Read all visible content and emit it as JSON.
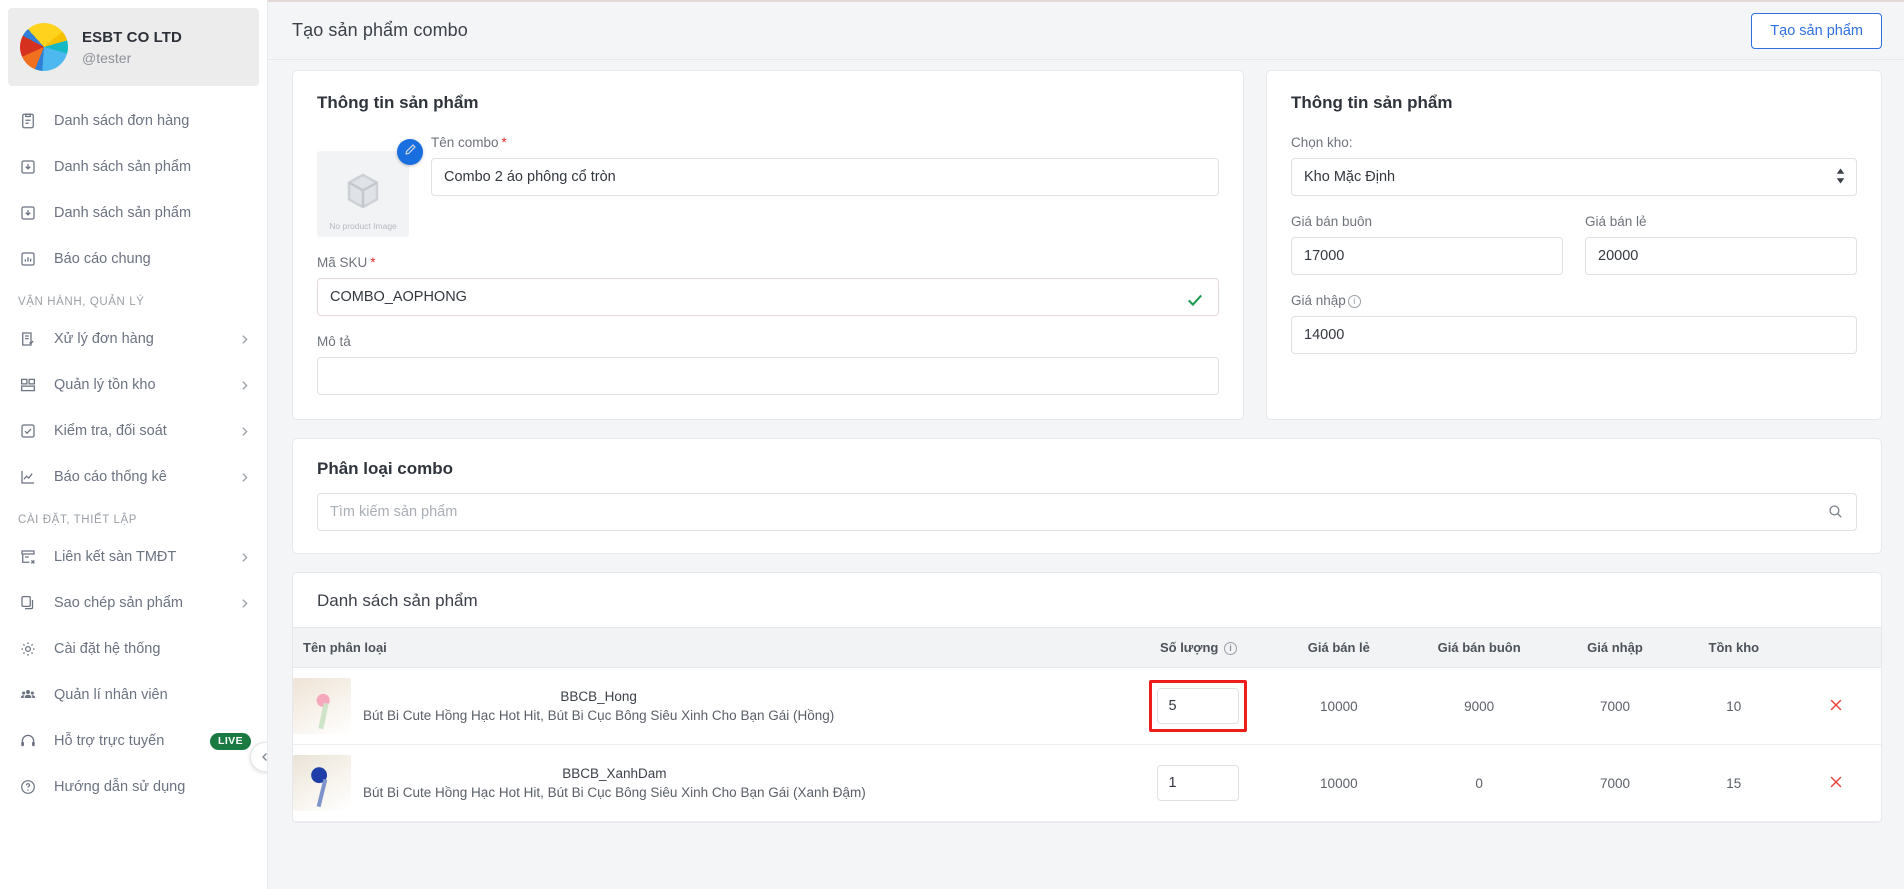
{
  "sidebar": {
    "brand": {
      "name": "ESBT CO LTD",
      "handle": "@tester"
    },
    "items": [
      {
        "label": "Danh sách đơn hàng",
        "icon": "clipboard-icon",
        "chevron": false
      },
      {
        "label": "Danh sách sản phẩm",
        "icon": "download-box-icon",
        "chevron": false
      },
      {
        "label": "Danh sách sản phẩm",
        "icon": "download-box-icon",
        "chevron": false
      },
      {
        "label": "Báo cáo chung",
        "icon": "bar-chart-icon",
        "chevron": false
      }
    ],
    "section_operations": "VẬN HÀNH, QUẢN LÝ",
    "operations": [
      {
        "label": "Xử lý đơn hàng",
        "icon": "order-process-icon",
        "chevron": true
      },
      {
        "label": "Quản lý tồn kho",
        "icon": "inventory-icon",
        "chevron": true
      },
      {
        "label": "Kiểm tra, đối soát",
        "icon": "checkbox-icon",
        "chevron": true
      },
      {
        "label": "Báo cáo thống kê",
        "icon": "line-chart-icon",
        "chevron": true
      }
    ],
    "section_settings": "CÀI ĐẶT, THIẾT LẬP",
    "settings": [
      {
        "label": "Liên kết sàn TMĐT",
        "icon": "store-link-icon",
        "chevron": true
      },
      {
        "label": "Sao chép sản phẩm",
        "icon": "copy-icon",
        "chevron": true
      },
      {
        "label": "Cài đặt hệ thống",
        "icon": "gear-icon",
        "chevron": false
      },
      {
        "label": "Quản lí nhân viên",
        "icon": "users-icon",
        "chevron": false
      },
      {
        "label": "Hỗ trợ trực tuyến",
        "icon": "headset-icon",
        "chevron": false,
        "badge": "LIVE"
      },
      {
        "label": "Hướng dẫn sử dụng",
        "icon": "question-circle-icon",
        "chevron": false
      }
    ]
  },
  "topbar": {
    "title": "Tạo sản phẩm combo",
    "create_button": "Tạo sản phẩm"
  },
  "product_info_left": {
    "title": "Thông tin sản phẩm",
    "thumb_caption": "No product Image",
    "combo_name_label": "Tên combo",
    "combo_name_value": "Combo 2 áo phông cổ tròn",
    "sku_label": "Mã SKU",
    "sku_value": "COMBO_AOPHONG",
    "desc_label": "Mô tả",
    "desc_value": "",
    "desc_placeholder": ""
  },
  "product_info_right": {
    "title": "Thông tin sản phẩm",
    "warehouse_label": "Chọn kho:",
    "warehouse_value": "Kho Mặc Định",
    "wholesale_label": "Giá bán buôn",
    "wholesale_value": "17000",
    "retail_label": "Giá bán lẻ",
    "retail_value": "20000",
    "import_label": "Giá nhập",
    "import_value": "14000"
  },
  "combo_category": {
    "title": "Phân loại combo",
    "search_value": "",
    "search_placeholder": "Tìm kiếm sản phẩm"
  },
  "product_list": {
    "title": "Danh sách sản phẩm",
    "columns": {
      "name": "Tên phân loại",
      "quantity": "Số lượng",
      "retail": "Giá bán lẻ",
      "wholesale": "Giá bán buôn",
      "import": "Giá nhập",
      "stock": "Tồn kho"
    },
    "rows": [
      {
        "sku": "BBCB_Hong",
        "desc": "Bút Bi Cute Hồng Hạc Hot Hit, Bút Bi Cục Bông Siêu Xinh Cho Bạn Gái (Hồng)",
        "quantity": "5",
        "retail": "10000",
        "wholesale": "9000",
        "import": "7000",
        "stock": "10",
        "highlighted": true
      },
      {
        "sku": "BBCB_XanhDam",
        "desc": "Bút Bi Cute Hồng Hạc Hot Hit, Bút Bi Cục Bông Siêu Xinh Cho Bạn Gái (Xanh Đậm)",
        "quantity": "1",
        "retail": "10000",
        "wholesale": "0",
        "import": "7000",
        "stock": "15",
        "highlighted": false
      }
    ]
  },
  "colors": {
    "accent": "#2f6fe0",
    "danger": "#e8453c",
    "highlight": "#ef1c1c",
    "success": "#1f9d55",
    "live_badge": "#1a7a42"
  }
}
